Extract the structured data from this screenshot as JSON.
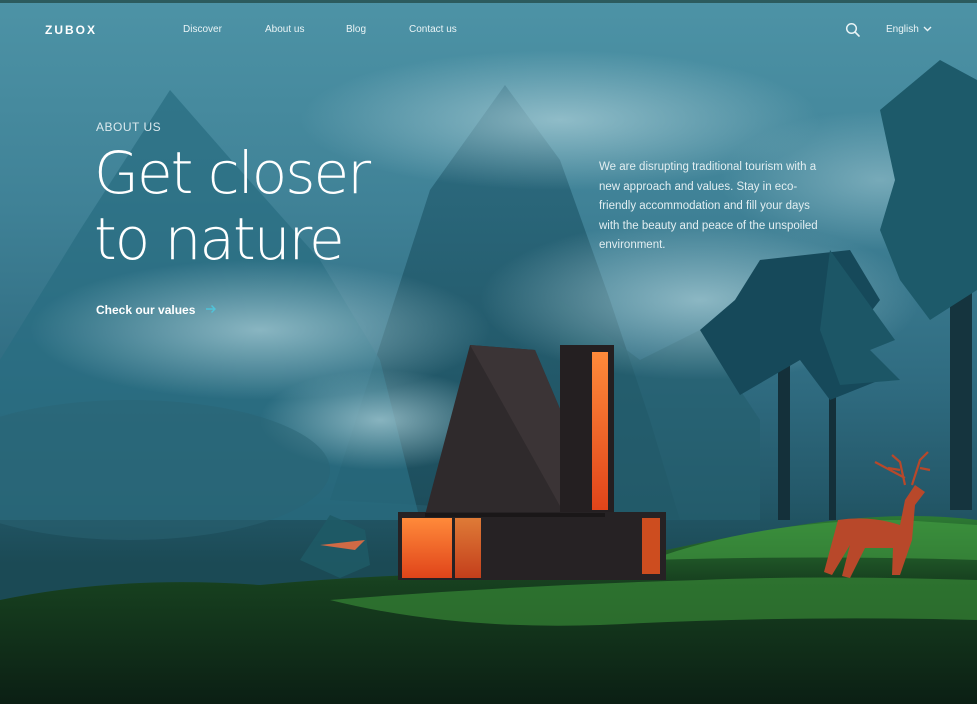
{
  "brand": {
    "logo": "ZUBOX"
  },
  "nav": {
    "items": [
      "Discover",
      "About us",
      "Blog",
      "Contact us"
    ]
  },
  "header": {
    "search_icon": "search-icon",
    "language": "English",
    "language_icon": "chevron-down-icon"
  },
  "hero": {
    "eyebrow": "ABOUT US",
    "title_line1": "Get closer",
    "title_line2": "to nature",
    "description": "We are disrupting traditional tourism with a new approach and values. Stay in eco-friendly accommodation and fill your days with the beauty and peace of the unspoiled environment.",
    "cta_label": "Check our values",
    "cta_icon": "arrow-right-icon"
  },
  "colors": {
    "accent": "#4fc3d9",
    "sky": "#3f8196",
    "grass": "#2f7a35",
    "window_glow": "#ff6a1f"
  }
}
